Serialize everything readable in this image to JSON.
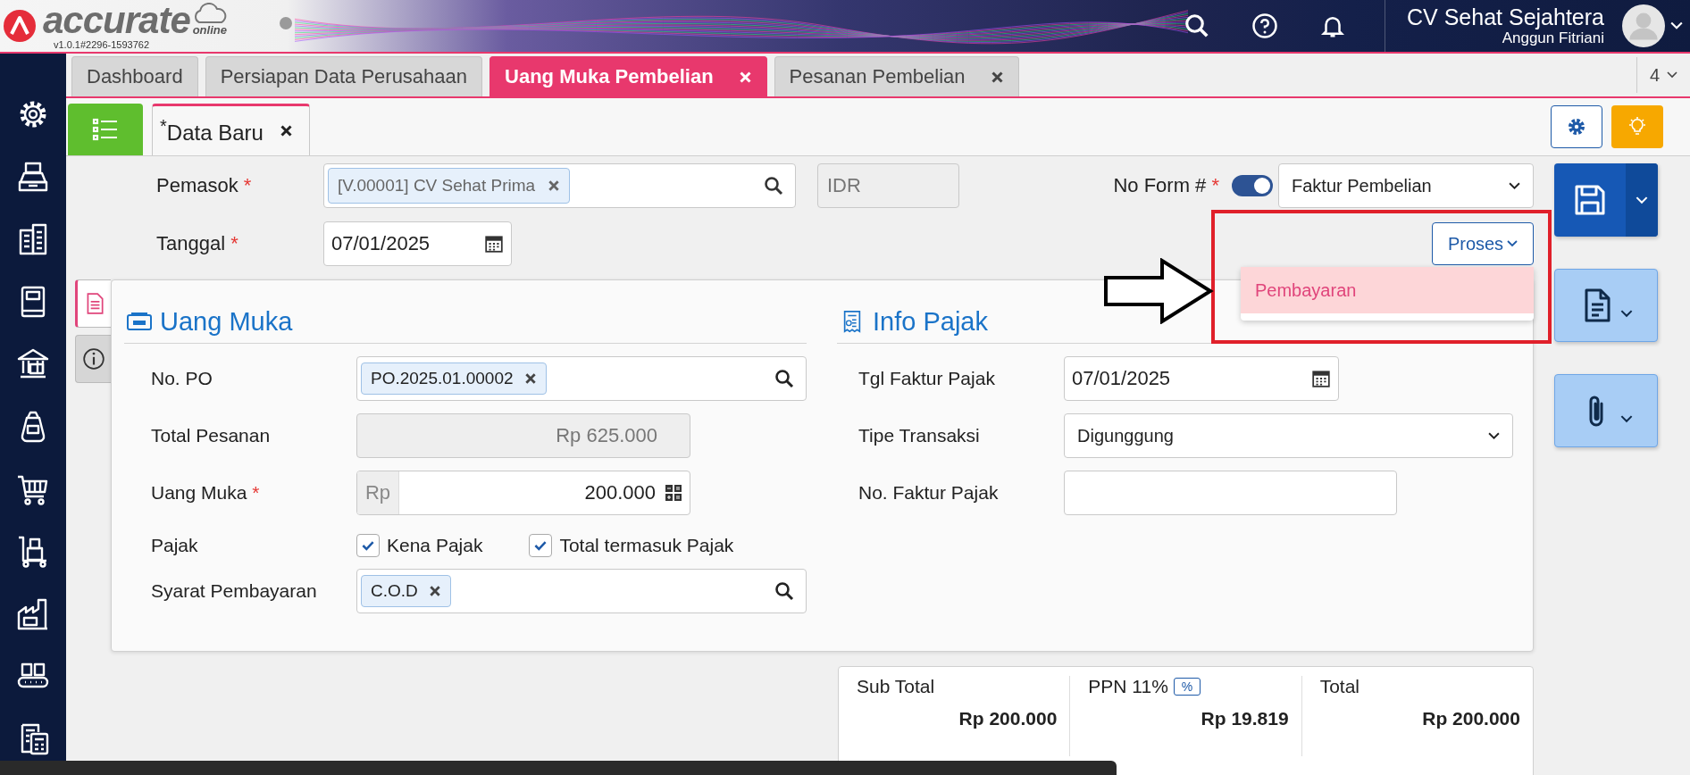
{
  "header": {
    "logo_text": "accurate",
    "logo_sub": "online",
    "version": "v1.0.1#2296-1593762",
    "company": "CV Sehat Sejahtera",
    "user": "Anggun Fitriani"
  },
  "tabs": [
    {
      "label": "Dashboard",
      "selected": false,
      "closable": false
    },
    {
      "label": "Persiapan Data Perusahaan",
      "selected": false,
      "closable": false
    },
    {
      "label": "Uang Muka Pembelian",
      "selected": true,
      "closable": true
    },
    {
      "label": "Pesanan Pembelian",
      "selected": false,
      "closable": true
    }
  ],
  "tab_count": "4",
  "subtabs": [
    {
      "label": "$^{*}$Data Baru",
      "selected": true
    }
  ],
  "form": {
    "supplier": {
      "label": "Pemasok",
      "required_mark": "*",
      "tag": "[V.00001] CV Sehat Prima"
    },
    "currency": "IDR",
    "date": {
      "label": "Tanggal",
      "required_mark": "*",
      "value": "07/01/2025"
    },
    "form_no": {
      "label": "No Form #",
      "required_mark": "*",
      "toggle_on": true,
      "value": "Faktur Pembelian"
    },
    "process_button": "Proses",
    "process_menu": [
      {
        "label": "Pembayaran",
        "selected": true
      }
    ]
  },
  "side_tabs": [
    {
      "kind": "document",
      "selected": true
    },
    {
      "kind": "info",
      "selected": false
    }
  ],
  "uang_muka": {
    "title": "Uang Muka",
    "rows": [
      {
        "kind": "tag_search",
        "label": "No. PO",
        "tag": "PO.2025.01.00002"
      },
      {
        "kind": "readonly",
        "label": "Total Pesanan",
        "value": "Rp 625.000"
      },
      {
        "kind": "amount",
        "label": "Uang Muka",
        "required_mark": "*",
        "prefix": "Rp",
        "value": "200.000"
      },
      {
        "kind": "checks",
        "label": "Pajak",
        "options": [
          {
            "label": "Kena Pajak",
            "checked": true
          },
          {
            "label": "Total termasuk Pajak",
            "checked": true
          }
        ]
      },
      {
        "kind": "tag_search",
        "label": "Syarat Pembayaran",
        "tag": "C.O.D"
      }
    ]
  },
  "info_pajak": {
    "title": "Info Pajak",
    "rows": [
      {
        "kind": "date",
        "label": "Tgl Faktur Pajak",
        "value": "07/01/2025"
      },
      {
        "kind": "select",
        "label": "Tipe Transaksi",
        "value": "Digunggung"
      },
      {
        "kind": "text",
        "label": "No. Faktur Pajak"
      }
    ]
  },
  "totals": [
    {
      "label": "Sub Total",
      "value": "Rp 200.000"
    },
    {
      "label": "PPN 11%",
      "badge": "%",
      "value": "Rp 19.819"
    },
    {
      "label": "Total",
      "value": "Rp 200.000"
    }
  ]
}
